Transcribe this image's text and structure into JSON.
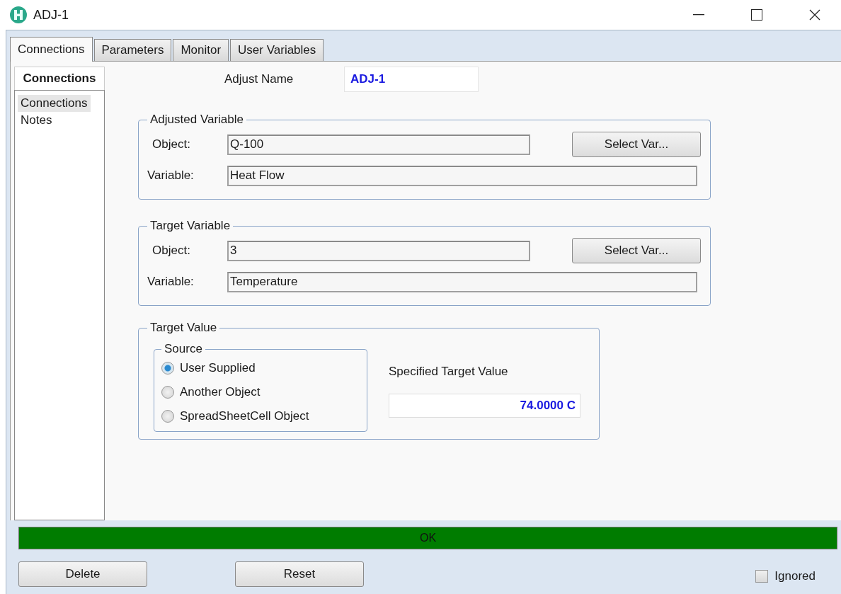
{
  "window": {
    "title": "ADJ-1"
  },
  "tabs": [
    {
      "label": "Connections",
      "selected": true
    },
    {
      "label": "Parameters",
      "selected": false
    },
    {
      "label": "Monitor",
      "selected": false
    },
    {
      "label": "User Variables",
      "selected": false
    }
  ],
  "nav": {
    "header": "Connections",
    "items": [
      {
        "label": "Connections",
        "selected": true
      },
      {
        "label": "Notes",
        "selected": false
      }
    ]
  },
  "adjust_name": {
    "label": "Adjust Name",
    "value": "ADJ-1"
  },
  "adjusted_variable": {
    "title": "Adjusted Variable",
    "object_label": "Object:",
    "object_value": "Q-100",
    "variable_label": "Variable:",
    "variable_value": "Heat Flow",
    "button": "Select Var..."
  },
  "target_variable": {
    "title": "Target Variable",
    "object_label": "Object:",
    "object_value": "3",
    "variable_label": "Variable:",
    "variable_value": "Temperature",
    "button": "Select Var..."
  },
  "target_value": {
    "title": "Target Value",
    "source": {
      "title": "Source",
      "options": [
        {
          "label": "User Supplied",
          "selected": true
        },
        {
          "label": "Another Object",
          "selected": false
        },
        {
          "label": "SpreadSheetCell Object",
          "selected": false
        }
      ]
    },
    "specified_label": "Specified Target Value",
    "specified_value": "74.0000 C"
  },
  "status": {
    "text": "OK"
  },
  "buttons": [
    "Delete",
    "Reset"
  ],
  "ignored": {
    "label": "Ignored",
    "checked": false
  }
}
